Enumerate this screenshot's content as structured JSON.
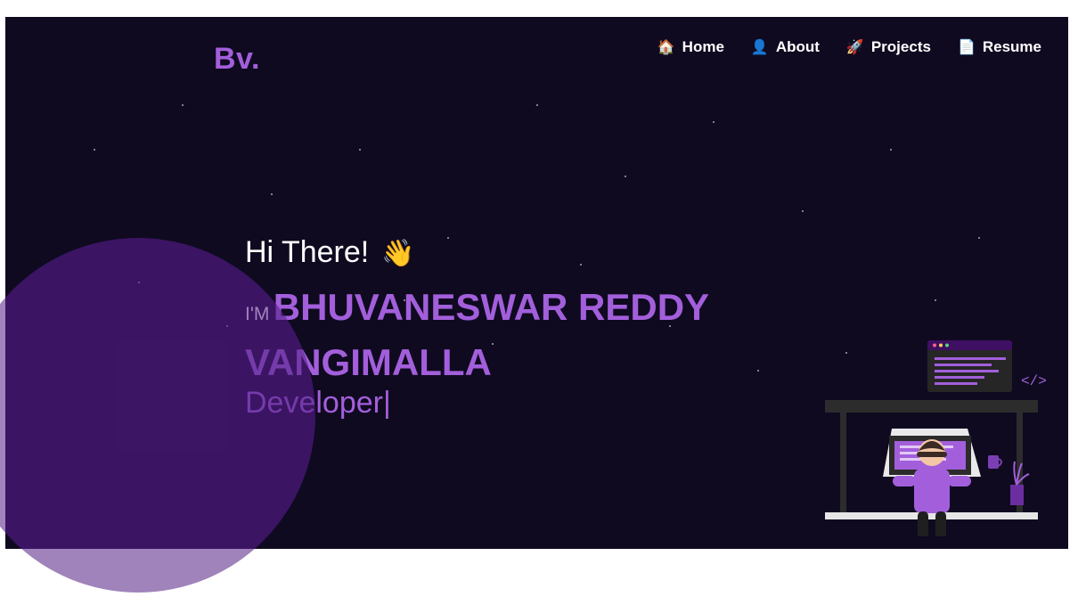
{
  "header": {
    "logo": "Bv.",
    "nav": [
      {
        "icon": "🏠",
        "label": "Home"
      },
      {
        "icon": "👤",
        "label": "About"
      },
      {
        "icon": "🚀",
        "label": "Projects"
      },
      {
        "icon": "📄",
        "label": "Resume"
      }
    ]
  },
  "hero": {
    "greeting": "Hi There!",
    "greeting_emoji": "👋",
    "im_prefix": "I'M",
    "name": "BHUVANESWAR REDDY VANGIMALLA",
    "typewriter_text": "Developer",
    "cursor": "|",
    "code_tag": "</>"
  },
  "colors": {
    "background": "#0f0a20",
    "accent": "#a35fdb",
    "text": "#ffffff"
  }
}
